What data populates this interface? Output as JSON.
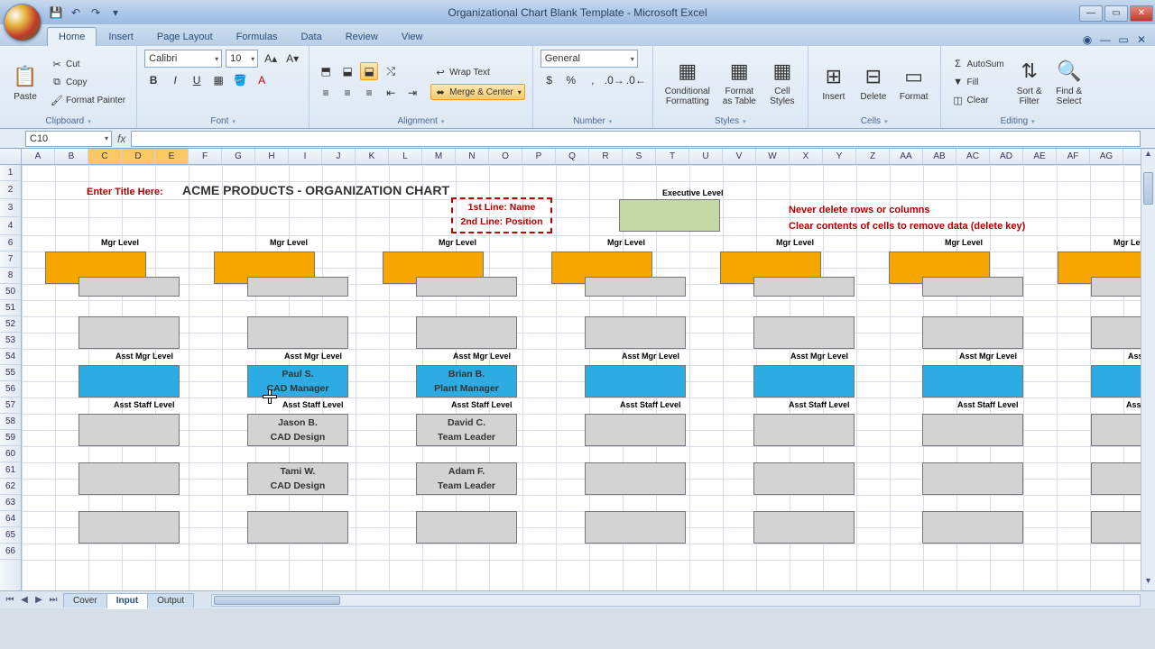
{
  "window": {
    "title": "Organizational Chart Blank Template - Microsoft Excel"
  },
  "qat": {
    "save": "💾",
    "undo": "↶",
    "redo": "↷"
  },
  "tabs": [
    "Home",
    "Insert",
    "Page Layout",
    "Formulas",
    "Data",
    "Review",
    "View"
  ],
  "active_tab": "Home",
  "ribbon": {
    "clipboard": {
      "label": "Clipboard",
      "paste": "Paste",
      "cut": "Cut",
      "copy": "Copy",
      "painter": "Format Painter"
    },
    "font": {
      "label": "Font",
      "name": "Calibri",
      "size": "10"
    },
    "alignment": {
      "label": "Alignment",
      "wrap": "Wrap Text",
      "merge": "Merge & Center"
    },
    "number": {
      "label": "Number",
      "format": "General"
    },
    "styles": {
      "label": "Styles",
      "cond": "Conditional\nFormatting",
      "table": "Format\nas Table",
      "cell": "Cell\nStyles"
    },
    "cells": {
      "label": "Cells",
      "insert": "Insert",
      "delete": "Delete",
      "format": "Format"
    },
    "editing": {
      "label": "Editing",
      "sum": "AutoSum",
      "fill": "Fill",
      "clear": "Clear",
      "sort": "Sort &\nFilter",
      "find": "Find &\nSelect"
    }
  },
  "namebox": "C10",
  "columns": [
    "A",
    "B",
    "C",
    "D",
    "E",
    "F",
    "G",
    "H",
    "I",
    "J",
    "K",
    "L",
    "M",
    "N",
    "O",
    "P",
    "Q",
    "R",
    "S",
    "T",
    "U",
    "V",
    "W",
    "X",
    "Y",
    "Z",
    "AA",
    "AB",
    "AC",
    "AD",
    "AE",
    "AF",
    "AG"
  ],
  "selected_col_indices": [
    2,
    3,
    4
  ],
  "row_numbers": [
    1,
    2,
    3,
    4,
    6,
    7,
    8,
    50,
    51,
    52,
    53,
    54,
    55,
    56,
    57,
    58,
    59,
    60,
    61,
    62,
    63,
    64,
    65,
    66
  ],
  "content": {
    "title_prompt": "Enter Title Here:",
    "title": "ACME PRODUCTS - ORGANIZATION CHART",
    "legend_line1": "1st Line: Name",
    "legend_line2": "2nd Line: Position",
    "exec_level": "Executive Level",
    "warn1": "Never delete rows or columns",
    "warn2": "Clear contents of cells to remove data (delete key)",
    "mgr_level": "Mgr Level",
    "asst_mgr_level": "Asst Mgr Level",
    "asst_staff_level": "Asst Staff Level",
    "asst_mgr": [
      {
        "name": "",
        "pos": ""
      },
      {
        "name": "Paul S.",
        "pos": "CAD Manager"
      },
      {
        "name": "Brian B.",
        "pos": "Plant Manager"
      },
      {
        "name": "",
        "pos": ""
      },
      {
        "name": "",
        "pos": ""
      },
      {
        "name": "",
        "pos": ""
      }
    ],
    "staff": {
      "col2": [
        {
          "name": "Jason B.",
          "pos": "CAD Design"
        },
        {
          "name": "Tami W.",
          "pos": "CAD Design"
        }
      ],
      "col3": [
        {
          "name": "David C.",
          "pos": "Team Leader"
        },
        {
          "name": "Adam F.",
          "pos": "Team Leader"
        }
      ]
    }
  },
  "sheets": {
    "tabs": [
      "Cover",
      "Input",
      "Output"
    ],
    "active": "Input"
  }
}
